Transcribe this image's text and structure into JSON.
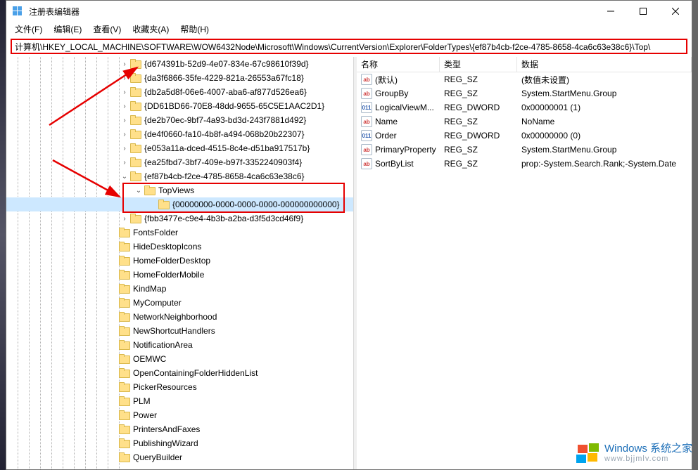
{
  "window": {
    "title": "注册表编辑器"
  },
  "menu": {
    "file": "文件(F)",
    "edit": "编辑(E)",
    "view": "查看(V)",
    "fav": "收藏夹(A)",
    "help": "帮助(H)"
  },
  "address": "计算机\\HKEY_LOCAL_MACHINE\\SOFTWARE\\WOW6432Node\\Microsoft\\Windows\\CurrentVersion\\Explorer\\FolderTypes\\{ef87b4cb-f2ce-4785-8658-4ca6c63e38c6}\\Top\\",
  "tree": [
    {
      "indent": 160,
      "exp": ">",
      "label": "{d674391b-52d9-4e07-834e-67c98610f39d}"
    },
    {
      "indent": 160,
      "exp": ">",
      "label": "{da3f6866-35fe-4229-821a-26553a67fc18}"
    },
    {
      "indent": 160,
      "exp": ">",
      "label": "{db2a5d8f-06e6-4007-aba6-af877d526ea6}"
    },
    {
      "indent": 160,
      "exp": ">",
      "label": "{DD61BD66-70E8-48dd-9655-65C5E1AAC2D1}"
    },
    {
      "indent": 160,
      "exp": ">",
      "label": "{de2b70ec-9bf7-4a93-bd3d-243f7881d492}"
    },
    {
      "indent": 160,
      "exp": ">",
      "label": "{de4f0660-fa10-4b8f-a494-068b20b22307}"
    },
    {
      "indent": 160,
      "exp": ">",
      "label": "{e053a11a-dced-4515-8c4e-d51ba917517b}"
    },
    {
      "indent": 160,
      "exp": ">",
      "label": "{ea25fbd7-3bf7-409e-b97f-3352240903f4}"
    },
    {
      "indent": 160,
      "exp": "v",
      "label": "{ef87b4cb-f2ce-4785-8658-4ca6c63e38c6}"
    },
    {
      "indent": 180,
      "exp": "v",
      "label": "TopViews"
    },
    {
      "indent": 200,
      "exp": "",
      "label": "{00000000-0000-0000-0000-000000000000}",
      "selected": true
    },
    {
      "indent": 160,
      "exp": ">",
      "label": "{fbb3477e-c9e4-4b3b-a2ba-d3f5d3cd46f9}"
    },
    {
      "indent": 144,
      "exp": "",
      "label": "FontsFolder"
    },
    {
      "indent": 144,
      "exp": "",
      "label": "HideDesktopIcons"
    },
    {
      "indent": 144,
      "exp": "",
      "label": "HomeFolderDesktop"
    },
    {
      "indent": 144,
      "exp": "",
      "label": "HomeFolderMobile"
    },
    {
      "indent": 144,
      "exp": "",
      "label": "KindMap"
    },
    {
      "indent": 144,
      "exp": "",
      "label": "MyComputer"
    },
    {
      "indent": 144,
      "exp": "",
      "label": "NetworkNeighborhood"
    },
    {
      "indent": 144,
      "exp": "",
      "label": "NewShortcutHandlers"
    },
    {
      "indent": 144,
      "exp": "",
      "label": "NotificationArea"
    },
    {
      "indent": 144,
      "exp": "",
      "label": "OEMWC"
    },
    {
      "indent": 144,
      "exp": "",
      "label": "OpenContainingFolderHiddenList"
    },
    {
      "indent": 144,
      "exp": "",
      "label": "PickerResources"
    },
    {
      "indent": 144,
      "exp": "",
      "label": "PLM"
    },
    {
      "indent": 144,
      "exp": "",
      "label": "Power"
    },
    {
      "indent": 144,
      "exp": "",
      "label": "PrintersAndFaxes"
    },
    {
      "indent": 144,
      "exp": "",
      "label": "PublishingWizard"
    },
    {
      "indent": 144,
      "exp": "",
      "label": "QueryBuilder"
    }
  ],
  "columns": {
    "name": "名称",
    "type": "类型",
    "data": "数据"
  },
  "values": [
    {
      "icon": "sz",
      "name": "(默认)",
      "type": "REG_SZ",
      "data": "(数值未设置)"
    },
    {
      "icon": "sz",
      "name": "GroupBy",
      "type": "REG_SZ",
      "data": "System.StartMenu.Group"
    },
    {
      "icon": "dw",
      "name": "LogicalViewM...",
      "type": "REG_DWORD",
      "data": "0x00000001 (1)"
    },
    {
      "icon": "sz",
      "name": "Name",
      "type": "REG_SZ",
      "data": "NoName"
    },
    {
      "icon": "dw",
      "name": "Order",
      "type": "REG_DWORD",
      "data": "0x00000000 (0)"
    },
    {
      "icon": "sz",
      "name": "PrimaryProperty",
      "type": "REG_SZ",
      "data": "System.StartMenu.Group"
    },
    {
      "icon": "sz",
      "name": "SortByList",
      "type": "REG_SZ",
      "data": "prop:-System.Search.Rank;-System.Date"
    }
  ],
  "watermark": {
    "line1": "Windows 系统之家",
    "line2": "www.bjjmlv.com"
  }
}
